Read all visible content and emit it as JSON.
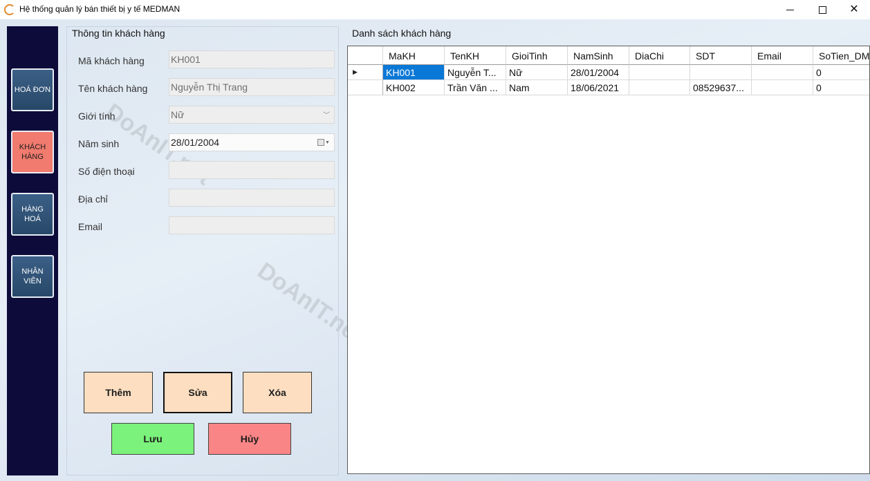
{
  "window": {
    "title": "Hệ thống quản lý bán thiết bị y tế MEDMAN"
  },
  "sidebar": {
    "items": [
      {
        "label": "HOÁ ĐƠN",
        "active": false
      },
      {
        "label": "KHÁCH HÀNG",
        "active": true
      },
      {
        "label": "HÀNG HOÁ",
        "active": false
      },
      {
        "label": "NHÂN VIÊN",
        "active": false
      }
    ]
  },
  "info": {
    "title": "Thông tin khách hàng",
    "fields": {
      "ma_label": "Mã khách hàng",
      "ma_value": "KH001",
      "ten_label": "Tên khách hàng",
      "ten_value": "Nguyễn Thị Trang",
      "gioitinh_label": "Giới tính",
      "gioitinh_value": "Nữ",
      "namsinh_label": "Năm sinh",
      "namsinh_value": "28/01/2004",
      "sdt_label": "Số điện thoại",
      "sdt_value": "",
      "diachi_label": "Địa chỉ",
      "diachi_value": "",
      "email_label": "Email",
      "email_value": ""
    },
    "buttons": {
      "add": "Thêm",
      "edit": "Sửa",
      "delete": "Xóa",
      "save": "Lưu",
      "cancel": "Hủy"
    }
  },
  "list": {
    "title": "Danh sách khách hàng",
    "columns": [
      "MaKH",
      "TenKH",
      "GioiTinh",
      "NamSinh",
      "DiaChi",
      "SDT",
      "Email",
      "SoTien_DM"
    ],
    "rows": [
      [
        "KH001",
        "Nguyễn T...",
        "Nữ",
        "28/01/2004",
        "",
        "",
        "",
        "0"
      ],
      [
        "KH002",
        "Trần Văn ...",
        "Nam",
        "18/06/2021",
        "",
        "08529637...",
        "",
        "0"
      ]
    ]
  },
  "watermark": "DoAnIT.net",
  "colors": {
    "sidebar_bg": "#0c0b3a",
    "active_nav": "#f07b6e",
    "action_btn": "#fddec0",
    "save_btn": "#7bf27b",
    "cancel_btn": "#f98586",
    "selection": "#0a78d7"
  },
  "icons": {
    "app": "app-icon",
    "minimize": "minimize-icon",
    "maximize": "maximize-icon",
    "close": "close-icon",
    "dropdown": "chevron-down-icon",
    "calendar": "calendar-icon",
    "row_pointer": "row-pointer-icon"
  }
}
